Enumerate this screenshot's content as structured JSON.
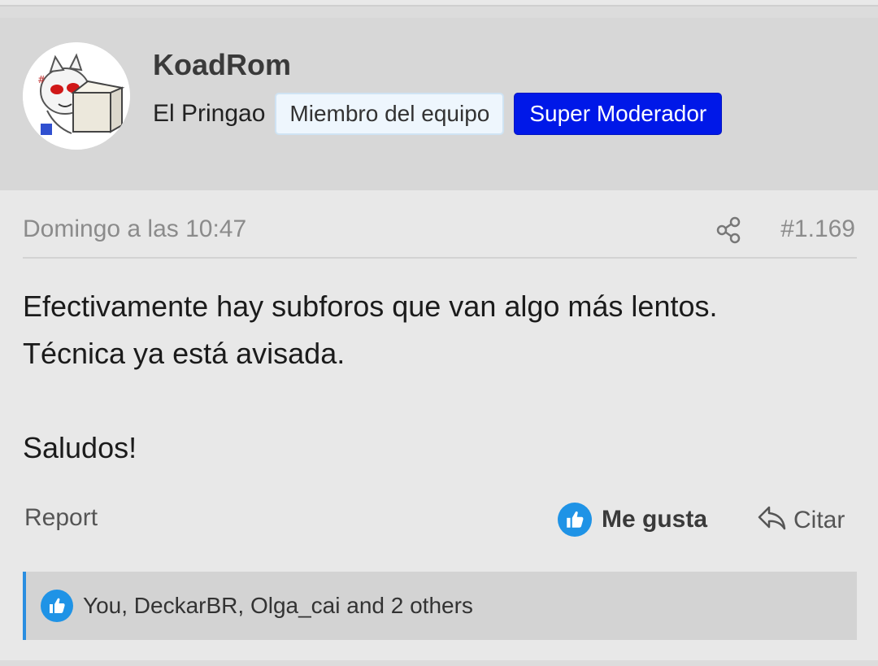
{
  "post": {
    "author": "KoadRom",
    "user_title": "El Pringao",
    "badges": [
      "Miembro del equipo",
      "Super Moderador"
    ],
    "date": "Domingo a las 10:47",
    "post_number": "#1.169",
    "body": [
      "Efectivamente hay subforos que van algo más lentos.",
      "Técnica ya está avisada.",
      "Saludos!"
    ]
  },
  "actions": {
    "report": "Report",
    "like": "Me gusta",
    "quote": "Citar"
  },
  "likes_summary": "You, DeckarBR, Olga_cai and 2 others",
  "icons": {
    "share": "share-icon",
    "like": "thumbs-up-icon",
    "quote": "reply-arrow-icon"
  },
  "colors": {
    "moderator_badge": "#0018e8",
    "like_blue": "#1f93e6",
    "header_bg": "#d7d7d7",
    "page_bg": "#e8e8e8"
  }
}
